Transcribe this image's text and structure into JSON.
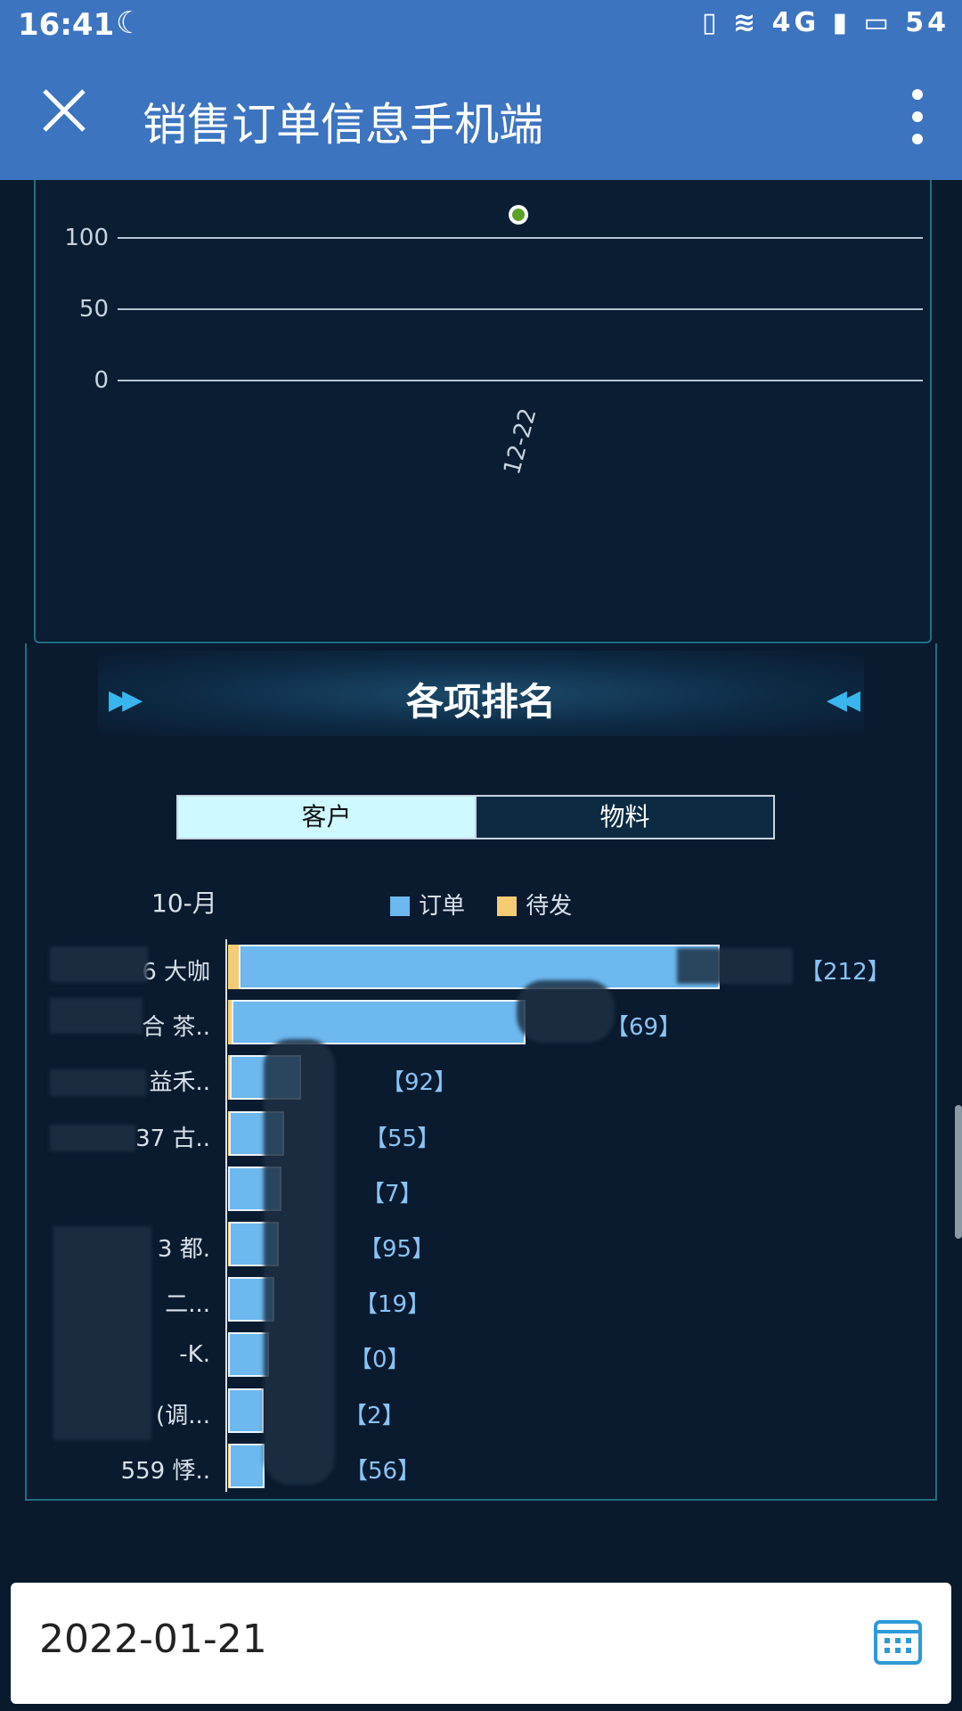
{
  "status_bar": {
    "time": "16:41",
    "moon_icon": "☾",
    "right_icons": "▯ ≋ 4G ▮ ▭ 54",
    "battery": "54"
  },
  "title_bar": {
    "title": "销售订单信息手机端",
    "close_icon": "close-icon",
    "more_icon": "more-vertical-icon"
  },
  "trend_chart": {
    "chart_data": {
      "type": "line",
      "x": [
        "12-22"
      ],
      "y": [
        120
      ],
      "y_ticks": [
        "100",
        "50",
        "0"
      ],
      "ylim": [
        0,
        100
      ],
      "grid": true
    }
  },
  "ranking": {
    "title": "各项排名",
    "arrow_left": "▶▶",
    "arrow_right": "◀◀",
    "tabs": [
      {
        "label": "客户",
        "active": true
      },
      {
        "label": "物料",
        "active": false
      }
    ],
    "period": "10-月",
    "legend": [
      {
        "label": "订单",
        "color": "#6cb8ef"
      },
      {
        "label": "待发",
        "color": "#f5cc74"
      }
    ]
  },
  "chart_data": {
    "type": "bar",
    "orientation": "horizontal",
    "categories": [
      "6 大咖",
      "合 茶..",
      "益禾..",
      "37 古..",
      "",
      "3 都.",
      "二...",
      "-K.",
      "(调...",
      "559 悸.."
    ],
    "value_labels": [
      "【212】",
      "【69】",
      "【92】",
      "【55】",
      "【7】",
      "【95】",
      "【19】",
      "【0】",
      "【2】",
      "【56】"
    ],
    "series": [
      {
        "name": "订单",
        "values": [
          540,
          330,
          80,
          62,
          60,
          56,
          52,
          46,
          40,
          40
        ]
      },
      {
        "name": "待发",
        "values": [
          12,
          4,
          2,
          1,
          0,
          1,
          0,
          0,
          0,
          1
        ]
      }
    ]
  },
  "date_bar": {
    "date": "2022-01-21",
    "calendar_icon": "calendar-icon"
  }
}
